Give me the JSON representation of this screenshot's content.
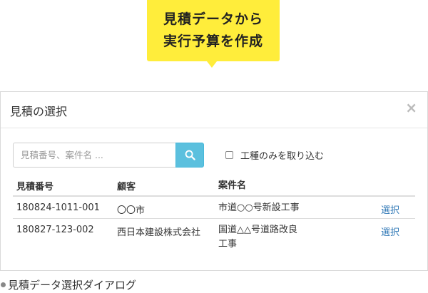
{
  "callout": {
    "line1": "見積データから",
    "line2": "実行予算を作成"
  },
  "dialog": {
    "title": "見積の選択",
    "close_label": "×",
    "search": {
      "placeholder": "見積番号、案件名 ...",
      "value": "",
      "button_icon": "search-icon"
    },
    "checkbox": {
      "label": "工種のみを取り込む",
      "checked": false
    },
    "table": {
      "headers": [
        "見積番号",
        "顧客",
        "案件名",
        ""
      ],
      "rows": [
        {
          "number": "180824-1011-001",
          "customer": "〇〇市",
          "project_line1": "市道○○号新設工事",
          "project_line2": "",
          "action": "選択"
        },
        {
          "number": "180827-123-002",
          "customer": "西日本建設株式会社",
          "project_line1": "国道△△号道路改良",
          "project_line2": "工事",
          "action": "選択"
        }
      ]
    }
  },
  "caption": "見積データ選択ダイアログ",
  "colors": {
    "callout_bg": "#ffed3b",
    "search_button": "#5bc0de",
    "link": "#337ab7"
  }
}
